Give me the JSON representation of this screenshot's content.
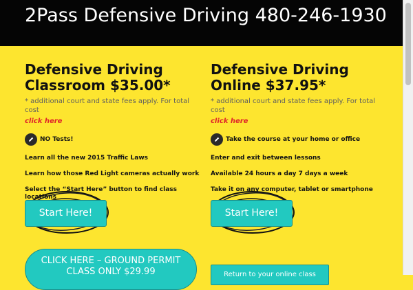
{
  "header": {
    "title": "2Pass Defensive Driving 480-246-1930"
  },
  "left": {
    "heading": "Defensive Driving Classroom $35.00*",
    "fee_note": "* additional  court and state fees apply.  For total cost",
    "click_here": "click here",
    "icon_feature": "NO Tests!",
    "lines": [
      "Learn all the new 2015 Traffic Laws",
      "Learn how those Red Light cameras actually work",
      "Select the “Start Here” button to find class locations"
    ],
    "start_button": "Start Here!",
    "pill_button": "CLICK HERE – GROUND PERMIT CLASS ONLY $29.99"
  },
  "right": {
    "heading": "Defensive Driving Online $37.95*",
    "fee_note": "* additional  court and state fees apply.  For total cost",
    "click_here": "click here",
    "icon_feature": "Take the course  at your home or office",
    "lines": [
      "Enter and exit between lessons",
      "Available 24 hours a day 7 days a week",
      "Take it on any computer, tablet or smartphone"
    ],
    "start_button": "Start Here!",
    "return_button": "Return to your online class"
  },
  "icons": {
    "left_feature_icon": "pencil-icon",
    "right_feature_icon": "pencil-icon"
  },
  "colors": {
    "background": "#fde52f",
    "header": "#050505",
    "button": "#22c9c0",
    "link": "#e0242a"
  }
}
